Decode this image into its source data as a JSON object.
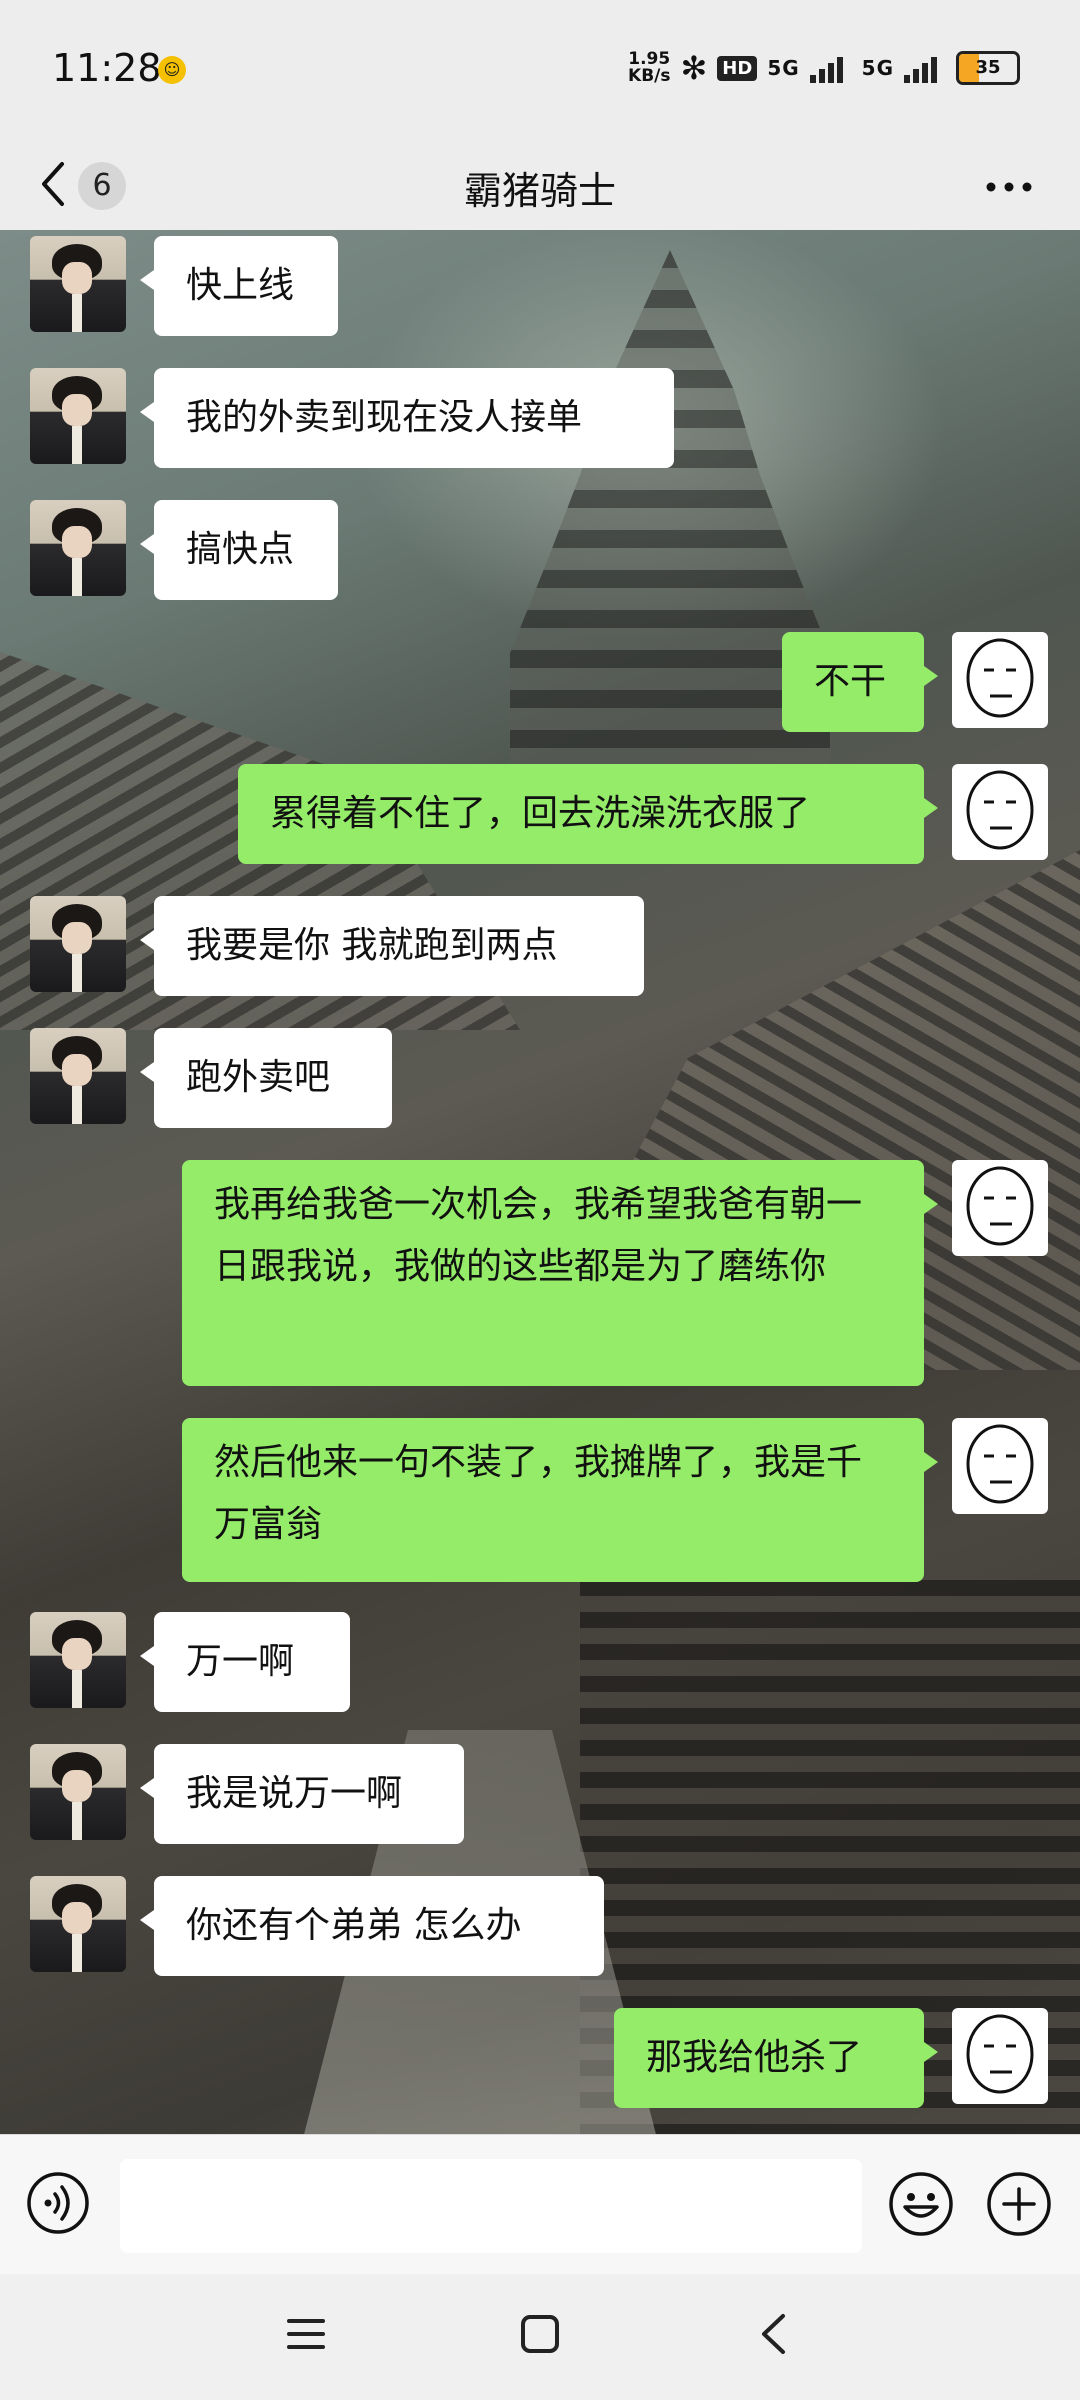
{
  "status_bar": {
    "time": "11:28",
    "net_speed_value": "1.95",
    "net_speed_unit": "KB/s",
    "hd_label": "HD",
    "sim1_label": "5G",
    "sim2_label": "5G",
    "battery_level": "35",
    "battery_fraction": 0.35
  },
  "header": {
    "unread_count": "6",
    "title": "霸猪骑士"
  },
  "messages": [
    {
      "side": "in",
      "text": "快上线"
    },
    {
      "side": "in",
      "text": "我的外卖到现在没人接单"
    },
    {
      "side": "in",
      "text": "搞快点"
    },
    {
      "side": "out",
      "text": "不干"
    },
    {
      "side": "out",
      "text": "累得着不住了，回去洗澡洗衣服了"
    },
    {
      "side": "in",
      "text": "我要是你 我就跑到两点"
    },
    {
      "side": "in",
      "text": "跑外卖吧"
    },
    {
      "side": "out",
      "text": "我再给我爸一次机会，我希望我爸有朝一日跟我说，我做的这些都是为了磨练你"
    },
    {
      "side": "out",
      "text": "然后他来一句不装了，我摊牌了，我是千万富翁"
    },
    {
      "side": "in",
      "text": "万一啊"
    },
    {
      "side": "in",
      "text": "我是说万一啊"
    },
    {
      "side": "in",
      "text": "你还有个弟弟 怎么办"
    },
    {
      "side": "out",
      "text": "那我给他杀了"
    }
  ],
  "input": {
    "value": "",
    "placeholder": ""
  },
  "icons": {
    "back": "chevron-left-icon",
    "more": "more-dots-icon",
    "voice": "voice-icon",
    "emoji": "emoji-icon",
    "plus": "plus-icon",
    "nav_menu": "menu-icon",
    "nav_home": "home-icon",
    "nav_back": "back-icon"
  },
  "colors": {
    "outgoing_bubble": "#95ec69",
    "incoming_bubble": "#ffffff",
    "battery": "#f5a623"
  }
}
